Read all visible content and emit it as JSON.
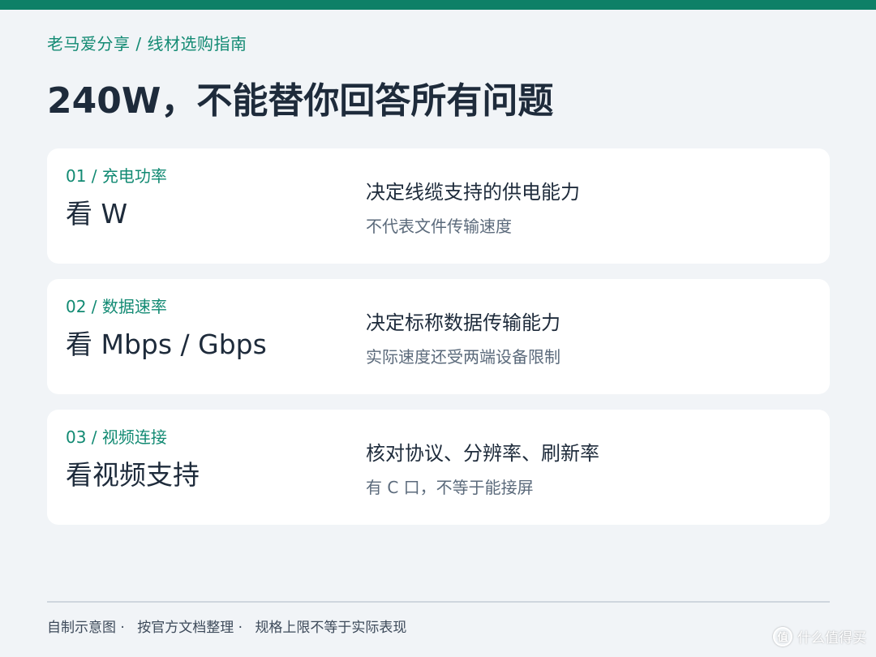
{
  "colors": {
    "accent": "#0e8067",
    "tag": "#128a73",
    "title": "#1e2b3b",
    "muted": "#5b6a7b",
    "background": "#f1f4f7",
    "card": "#ffffff"
  },
  "breadcrumb": "老马爱分享 / 线材选购指南",
  "title": "240W，不能替你回答所有问题",
  "cards": [
    {
      "tag": "01 / 充电功率",
      "heading": "看 W",
      "desc": "决定线缆支持的供电能力",
      "note": "不代表文件传输速度"
    },
    {
      "tag": "02 / 数据速率",
      "heading": "看 Mbps / Gbps",
      "desc": "决定标称数据传输能力",
      "note": "实际速度还受两端设备限制"
    },
    {
      "tag": "03 / 视频连接",
      "heading": "看视频支持",
      "desc": "核对协议、分辨率、刷新率",
      "note": "有 C 口，不等于能接屏"
    }
  ],
  "footer": {
    "items": [
      "自制示意图 ·",
      "按官方文档整理 ·",
      "规格上限不等于实际表现"
    ]
  },
  "watermark": {
    "logo": "值",
    "text": "什么值得买"
  }
}
